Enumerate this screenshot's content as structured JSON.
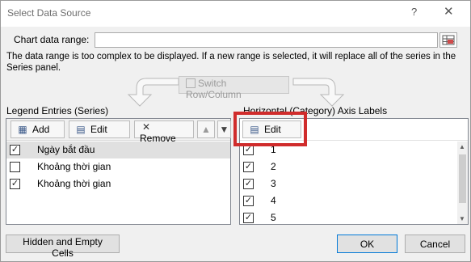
{
  "window": {
    "title": "Select Data Source",
    "help": "?",
    "close": "✕"
  },
  "range": {
    "label": "Chart data range:",
    "value": ""
  },
  "message": "The data range is too complex to be displayed. If a new range is selected, it will replace all of the series in the Series panel.",
  "switch_label": "Switch Row/Column",
  "legend": {
    "title": "Legend Entries (Series)",
    "add": "Add",
    "edit": "Edit",
    "remove": "Remove",
    "items": [
      {
        "label": "Ngày bắt đầu",
        "checked": true,
        "selected": true
      },
      {
        "label": "Khoảng thời gian",
        "checked": false,
        "selected": false
      },
      {
        "label": "Khoảng thời gian",
        "checked": true,
        "selected": false
      }
    ]
  },
  "axis": {
    "title": "Horizontal (Category) Axis Labels",
    "edit": "Edit",
    "items": [
      {
        "label": "1",
        "checked": true
      },
      {
        "label": "2",
        "checked": true
      },
      {
        "label": "3",
        "checked": true
      },
      {
        "label": "4",
        "checked": true
      },
      {
        "label": "5",
        "checked": true
      }
    ]
  },
  "buttons": {
    "hidden_empty": "Hidden and Empty Cells",
    "ok": "OK",
    "cancel": "Cancel"
  },
  "colors": {
    "highlight": "#d02c2c",
    "dialog_bg": "#f0f0f0"
  }
}
